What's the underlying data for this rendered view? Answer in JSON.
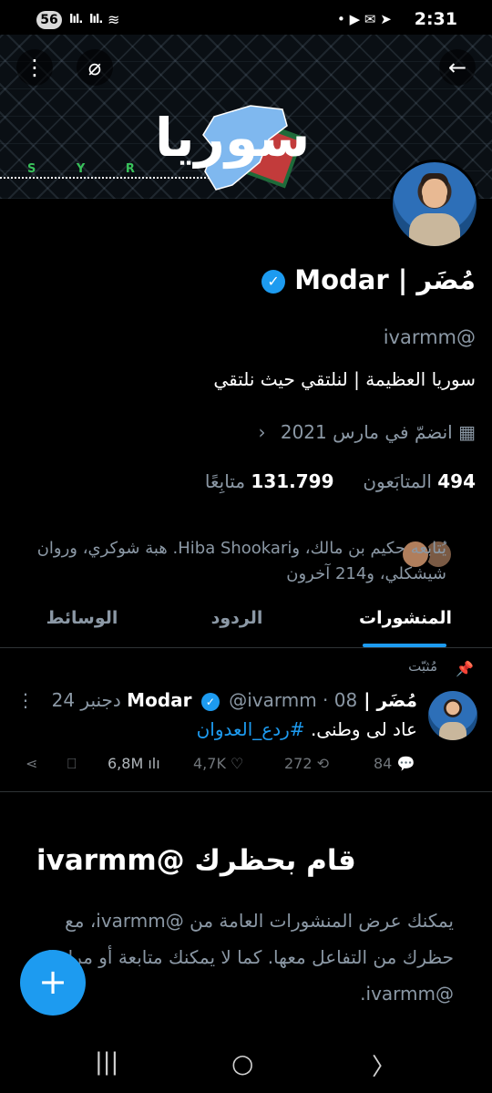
{
  "status_bar": {
    "badge": "56",
    "signal1": "lıl.",
    "signal2": "lıl.",
    "time": "2:31",
    "icons": "• ▶ ✉ ➤"
  },
  "banner": {
    "text": "سوريا",
    "subtext": "S Y R"
  },
  "header": {
    "back_icon": "←",
    "more_icon": "⋮",
    "network_icon": "⌀"
  },
  "profile": {
    "name": "مُضَر | Modar",
    "verified_icon": "✓",
    "handle": "@ivarmm",
    "bio": "سوريا العظيمة | لنلتقي حيث نلتقي",
    "joined": "انضمّ في مارس 2021",
    "joined_chevron": "‹",
    "calendar_icon": "▦",
    "followers_count": "494",
    "followers_label": "المتابَعون",
    "following_count": "131.799",
    "following_label": "متابِعًا",
    "followed_by": "يُتابعه حكيم بن مالك، وHiba Shookari. هبة شوكري، وروان شيشكلي، و214 آخرون"
  },
  "tabs": [
    {
      "label": "المنشورات",
      "active": true
    },
    {
      "label": "الردود",
      "active": false
    },
    {
      "label": "الوسائط",
      "active": false
    }
  ],
  "post": {
    "pinned_label": "مُثبّت",
    "pin_icon": "📌",
    "name": "مُضَر | Modar",
    "handle_date": "@ivarmm · 08 دجنبر 24",
    "body_text": "عاد لى وطنى.",
    "hashtag": "#ردع_العدوان",
    "more_icon": "⋮",
    "replies": "84",
    "reposts": "272",
    "likes": "4,7K",
    "views": "6,8M",
    "reply_icon": "💬",
    "repost_icon": "⟲",
    "like_icon": "♡",
    "views_icon": "ılı",
    "bookmark_icon": "⎕",
    "share_icon": "⋖"
  },
  "blocked": {
    "title": "قام بحظرك @ivarmm",
    "text": "يمكنك عرض المنشورات العامة من @ivarmm، مع حظرك من التفاعل معها. كما لا يمكنك متابعة أو مراسلة @ivarmm."
  },
  "fab": {
    "icon": "+"
  },
  "navbar": {
    "recents_icon": "|||",
    "home_icon": "○",
    "back_icon": "〉"
  },
  "colors": {
    "accent": "#1d9bf0",
    "background": "#000000",
    "muted": "#8b98a5"
  }
}
